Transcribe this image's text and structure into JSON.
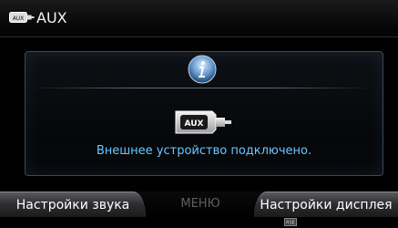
{
  "header": {
    "title": "AUX",
    "icon": "aux-source-icon",
    "icon_label": "AUX"
  },
  "panel": {
    "info_icon": "info-icon",
    "device_icon": "aux-plug-icon",
    "device_label": "AUX",
    "message": "Внешнее устройство подключено."
  },
  "menu": {
    "left_label": "Настройки звука",
    "center_label": "МЕНЮ",
    "right_label": "Настройки дисплея"
  },
  "status": {
    "icon": "status-icon",
    "icon_label": "RSE"
  },
  "colors": {
    "message": "#6cc6ff",
    "panel_border": "#3a4a5a",
    "menu_disabled": "#5e6063"
  }
}
